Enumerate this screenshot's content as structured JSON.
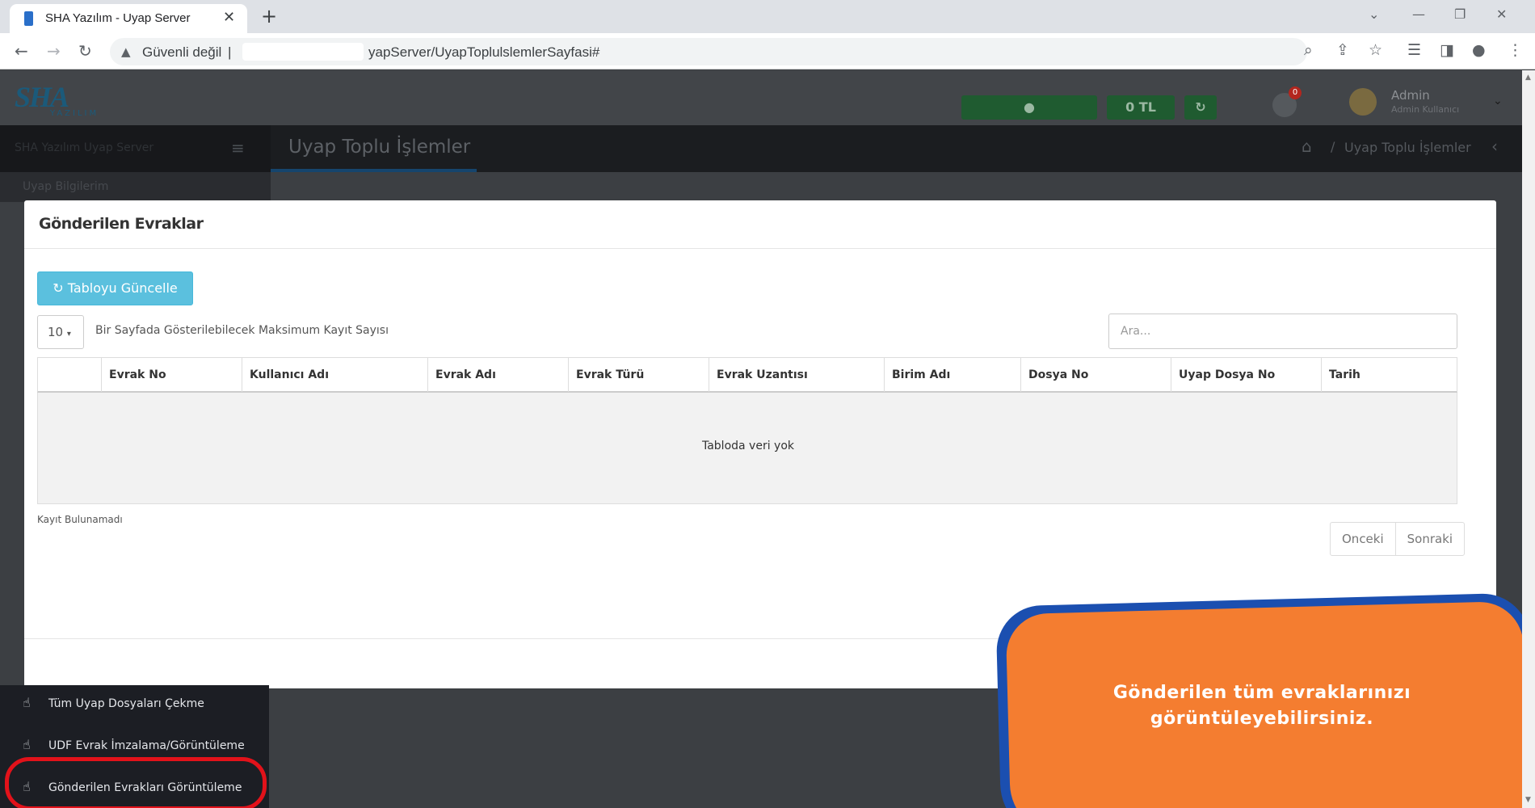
{
  "browser": {
    "tab_title": "SHA Yazılım - Uyap Server",
    "security_label": "Güvenli değil",
    "url_visible": "yapServer/UyapToplulslemlerSayfasi#"
  },
  "app_header": {
    "logo_text": "SHA",
    "logo_sub": "YAZILIM",
    "balance_label": "0 TL",
    "notification_count": "0",
    "user_name": "Admin",
    "user_role": "Admin Kullanıcı"
  },
  "app_titlebar": {
    "brand_text": "SHA Yazılım Uyap Server",
    "page_heading": "Uyap Toplu İşlemler",
    "breadcrumb": "Uyap Toplu İşlemler",
    "sidebar_first_item": "Uyap Bilgilerim"
  },
  "modal": {
    "title": "Gönderilen Evraklar",
    "refresh_button": "Tabloyu Güncelle",
    "page_length": "10",
    "page_length_label": "Bir Sayfada Gösterilebilecek Maksimum Kayıt Sayısı",
    "search_placeholder": "Ara...",
    "columns": [
      "",
      "Evrak No",
      "Kullanıcı Adı",
      "Evrak Adı",
      "Evrak Türü",
      "Evrak Uzantısı",
      "Birim Adı",
      "Dosya No",
      "Uyap Dosya No",
      "Tarih"
    ],
    "empty_message": "Tabloda veri yok",
    "info_text": "Kayıt Bulunamadı",
    "prev_button": "Onceki",
    "next_button": "Sonraki"
  },
  "sidebar_menu": {
    "items": [
      {
        "label": "Tüm Uyap Dosyaları Çekme"
      },
      {
        "label": "UDF Evrak İmzalama/Görüntüleme"
      },
      {
        "label": "Gönderilen Evrakları Görüntüleme"
      }
    ]
  },
  "callout": {
    "line1": "Gönderilen tüm evraklarınızı",
    "line2": "görüntüleyebilirsiniz."
  },
  "colors": {
    "accent": "#5bc0de",
    "callout_fill": "#f47d30",
    "callout_border": "#1b4fb0",
    "highlight_ring": "#e2121a"
  }
}
